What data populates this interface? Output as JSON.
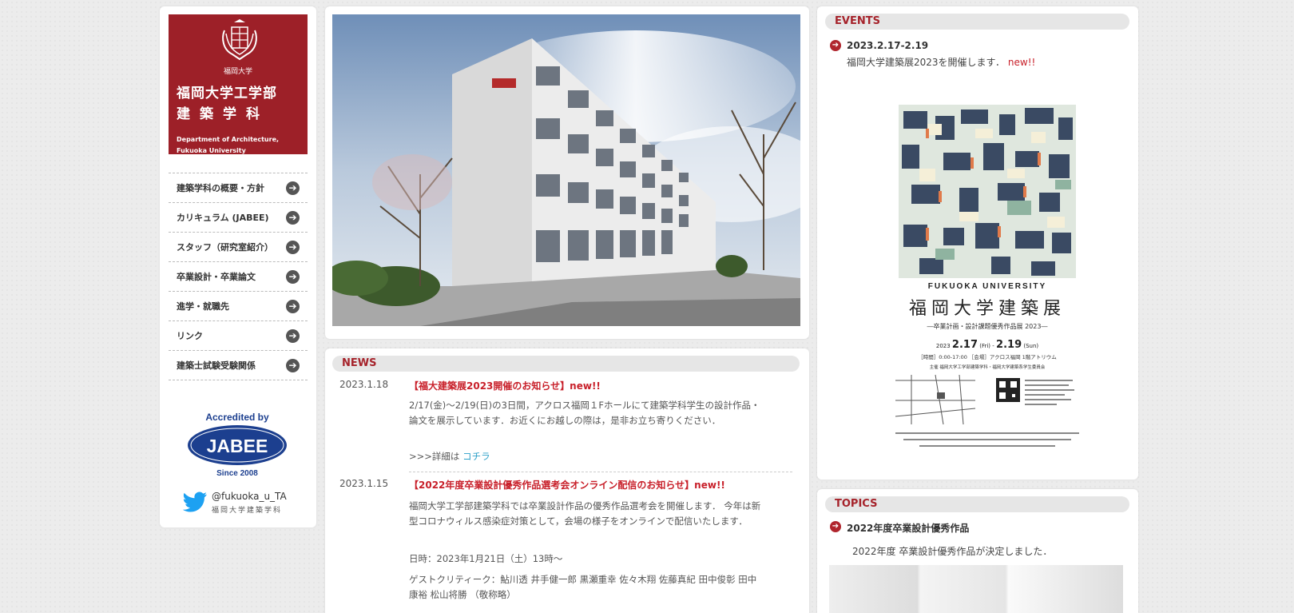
{
  "logo": {
    "univ_small": "福岡大学",
    "line1": "福岡大学工学部",
    "line2": "建築学科",
    "en1": "Department of Architecture,",
    "en2": "Fukuoka University",
    "color": "#9d2028"
  },
  "menu": [
    {
      "label": "建築学科の概要・方針",
      "icon": "arrow-right-icon"
    },
    {
      "label": "カリキュラム (JABEE)",
      "icon": "arrow-right-icon"
    },
    {
      "label": "スタッフ（研究室紹介）",
      "icon": "arrow-right-icon"
    },
    {
      "label": "卒業設計・卒業論文",
      "icon": "arrow-right-icon"
    },
    {
      "label": "進学・就職先",
      "icon": "arrow-right-icon"
    },
    {
      "label": "リンク",
      "icon": "arrow-right-icon"
    },
    {
      "label": "建築士試験受験関係",
      "icon": "arrow-right-icon"
    }
  ],
  "jabee": {
    "top": "Accredited by",
    "name": "JABEE",
    "since": "Since 2008"
  },
  "twitter": {
    "handle": "@fukuoka_u_TA",
    "sub": "福岡大学建築学科"
  },
  "news": {
    "heading": "NEWS",
    "items": [
      {
        "date": "2023.1.18",
        "title": "【福大建築展2023開催のお知らせ】",
        "new": "new!!",
        "body1": "2/17(金)〜2/19(日)の3日間，アクロス福岡１Fホールにて建築学科学生の設計作品・",
        "body2": "論文を展示しています．お近くにお越しの際は，是非お立ち寄りください．",
        "more": ">>>詳細は",
        "link": "コチラ"
      },
      {
        "date": "2023.1.15",
        "title": "【2022年度卒業設計優秀作品選考会オンライン配信のお知らせ】",
        "new": "new!!",
        "body1": "福岡大学工学部建築学科では卒業設計作品の優秀作品選考会を開催します． 今年は新",
        "body2": "型コロナウィルス感染症対策として，会場の様子をオンラインで配信いたします．",
        "datetime": "日時：2023年1月21日（土）13時〜",
        "guests1": "ゲストクリティーク：鮎川透 井手健一郎 黒瀬重幸 佐々木翔 佐藤真紀 田中俊彰 田中",
        "guests2": "康裕 松山将勝 （敬称略）"
      }
    ]
  },
  "events": {
    "heading": "EVENTS",
    "date": "2023.2.17-2.19",
    "text": "福岡大学建築展2023を開催します．",
    "new": "new!!",
    "poster": {
      "univ": "FUKUOKA UNIVERSITY",
      "title": "福岡大学建築展",
      "subtitle": "―卒業計画・設計課題優秀作品展 2023―",
      "dates_prefix": "2023",
      "date_start": "2.17",
      "date_start_day": "(Fri)",
      "date_sep": "-",
      "date_end": "2.19",
      "date_end_day": "(Sun)",
      "venue": "［時間］0:00-17:00 ［会場］アクロス福岡 1階アトリウム",
      "organizer": "主催 福岡大学工学部建築学科・福岡大学建築系学生委員会"
    }
  },
  "topics": {
    "heading": "TOPICS",
    "title": "2022年度卒業設計優秀作品",
    "text": "2022年度 卒業設計優秀作品が決定しました．"
  },
  "colors": {
    "accent": "#a6232b",
    "link": "#2ca0c8",
    "new": "#c8202a",
    "twitter": "#1da1f2",
    "jabee": "#1c3f8f"
  }
}
